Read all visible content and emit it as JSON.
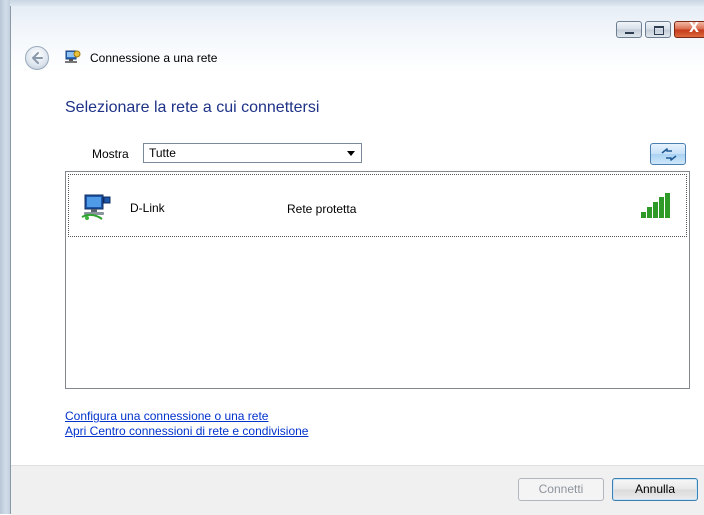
{
  "window": {
    "title": "Connessione a una rete",
    "close_symbol": "X"
  },
  "heading": "Selezionare la rete a cui connettersi",
  "filter": {
    "label": "Mostra",
    "selected": "Tutte"
  },
  "networks": [
    {
      "name": "D-Link",
      "security": "Rete protetta",
      "icon": "wireless-network-icon",
      "signal_icon": "signal-strength-icon",
      "signal_bars": 5
    }
  ],
  "links": {
    "setup": "Configura una connessione o una rete",
    "network_center": "Apri Centro connessioni di rete e condivisione"
  },
  "buttons": {
    "connect": "Connetti",
    "cancel": "Annulla"
  },
  "colors": {
    "heading": "#1e3287",
    "link": "#0033cc",
    "signal": "#2e9a28"
  }
}
